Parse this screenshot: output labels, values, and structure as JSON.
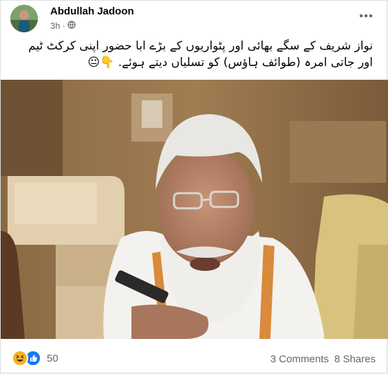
{
  "post": {
    "author": "Abdullah Jadoon",
    "time": "3h",
    "privacy_icon": "globe-icon",
    "more_icon": "more-options-icon",
    "text": "نواز شریف کے سگے بھائی اور پٹواریوں کے بڑے ابا حضور  اپنی کرکٹ ٹیم اور جاتی امرہ (طوائف ہاؤس) کو تسلیاں دیتے ہوئے. 👇😐"
  },
  "footer": {
    "reaction_icons": [
      "haha-reaction-icon",
      "like-reaction-icon"
    ],
    "reaction_count": "50",
    "comments": "3 Comments",
    "shares": "8 Shares"
  }
}
